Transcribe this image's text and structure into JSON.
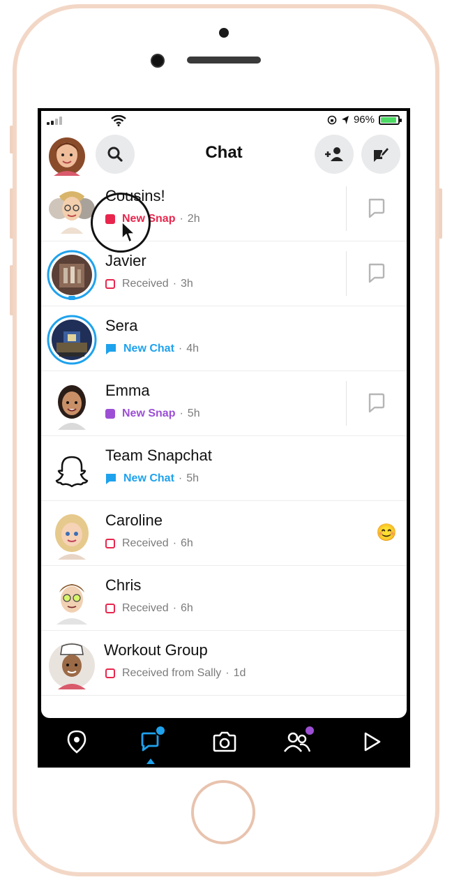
{
  "status_bar": {
    "battery_percent": "96%"
  },
  "header": {
    "title": "Chat",
    "icons": [
      "profile-avatar",
      "search-icon",
      "add-friend-icon",
      "new-chat-icon"
    ]
  },
  "chats": [
    {
      "name": "Cousins!",
      "status": "New Snap",
      "time": "2h",
      "status_color": "#e8264d",
      "kind": "snap",
      "filled": true,
      "action": "reply"
    },
    {
      "name": "Javier",
      "status": "Received",
      "time": "3h",
      "status_color": "#e8264d",
      "kind": "snap",
      "filled": false,
      "action": "reply"
    },
    {
      "name": "Sera",
      "status": "New Chat",
      "time": "4h",
      "status_color": "#1ea2ed",
      "kind": "chat",
      "filled": true,
      "action": "none"
    },
    {
      "name": "Emma",
      "status": "New Snap",
      "time": "5h",
      "status_color": "#9c4fd4",
      "kind": "snap",
      "filled": true,
      "action": "reply"
    },
    {
      "name": "Team Snapchat",
      "status": "New Chat",
      "time": "5h",
      "status_color": "#1ea2ed",
      "kind": "chat",
      "filled": true,
      "action": "none"
    },
    {
      "name": "Caroline",
      "status": "Received",
      "time": "6h",
      "status_color": "#e8264d",
      "kind": "snap",
      "filled": false,
      "action": "emoji",
      "emoji": "😊"
    },
    {
      "name": "Chris",
      "status": "Received",
      "time": "6h",
      "status_color": "#e8264d",
      "kind": "snap",
      "filled": false,
      "action": "none"
    },
    {
      "name": "Workout Group",
      "status": "Received from Sally",
      "time": "1d",
      "status_color": "#e8264d",
      "kind": "snap",
      "filled": false,
      "action": "none"
    }
  ],
  "tabbar": {
    "items": [
      "map-icon",
      "chat-icon",
      "camera-icon",
      "friends-icon",
      "discover-icon"
    ],
    "active": "chat-icon",
    "accent": "#1ea2ed",
    "badge_chat": "#1ea2ed",
    "badge_friends": "#9c4fd4"
  }
}
